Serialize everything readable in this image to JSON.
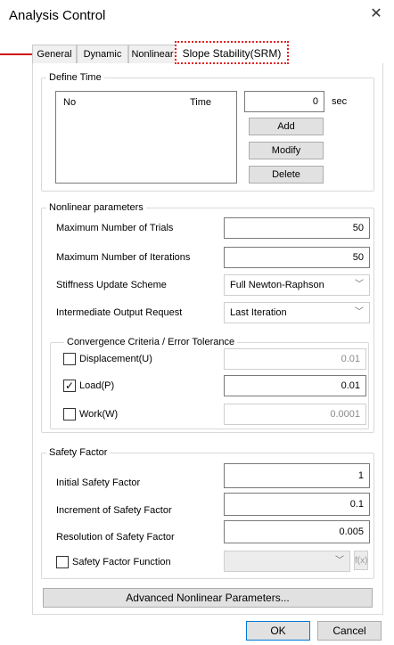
{
  "window": {
    "title": "Analysis Control"
  },
  "tabs": [
    {
      "label": "General"
    },
    {
      "label": "Dynamic"
    },
    {
      "label": "Nonlinear"
    },
    {
      "label": "Slope Stability(SRM)"
    }
  ],
  "define_time": {
    "title": "Define Time",
    "col_no": "No",
    "col_time": "Time",
    "time_value": "0",
    "unit": "sec",
    "add": "Add",
    "modify": "Modify",
    "delete": "Delete"
  },
  "nonlinear": {
    "title": "Nonlinear parameters",
    "max_trials_label": "Maximum Number of Trials",
    "max_trials": "50",
    "max_iter_label": "Maximum Number of Iterations",
    "max_iter": "50",
    "stiffness_label": "Stiffness Update Scheme",
    "stiffness_value": "Full Newton-Raphson",
    "output_label": "Intermediate Output Request",
    "output_value": "Last Iteration",
    "convergence": {
      "title": "Convergence Criteria / Error Tolerance",
      "disp_label": "Displacement(U)",
      "disp_value": "0.01",
      "disp_checked": false,
      "load_label": "Load(P)",
      "load_value": "0.01",
      "load_checked": true,
      "work_label": "Work(W)",
      "work_value": "0.0001",
      "work_checked": false
    }
  },
  "safety": {
    "title": "Safety Factor",
    "initial_label": "Initial Safety Factor",
    "initial": "1",
    "increment_label": "Increment of Safety Factor",
    "increment": "0.1",
    "resolution_label": "Resolution of Safety Factor",
    "resolution": "0.005",
    "function_label": "Safety Factor Function",
    "function_value": ""
  },
  "advanced_button": "Advanced Nonlinear Parameters...",
  "ok": "OK",
  "cancel": "Cancel",
  "icons": {
    "close": "close-icon",
    "arrow": "annotation-arrow",
    "check": "✓",
    "chevron": "chevron-down-icon",
    "fx": "f(x)"
  }
}
